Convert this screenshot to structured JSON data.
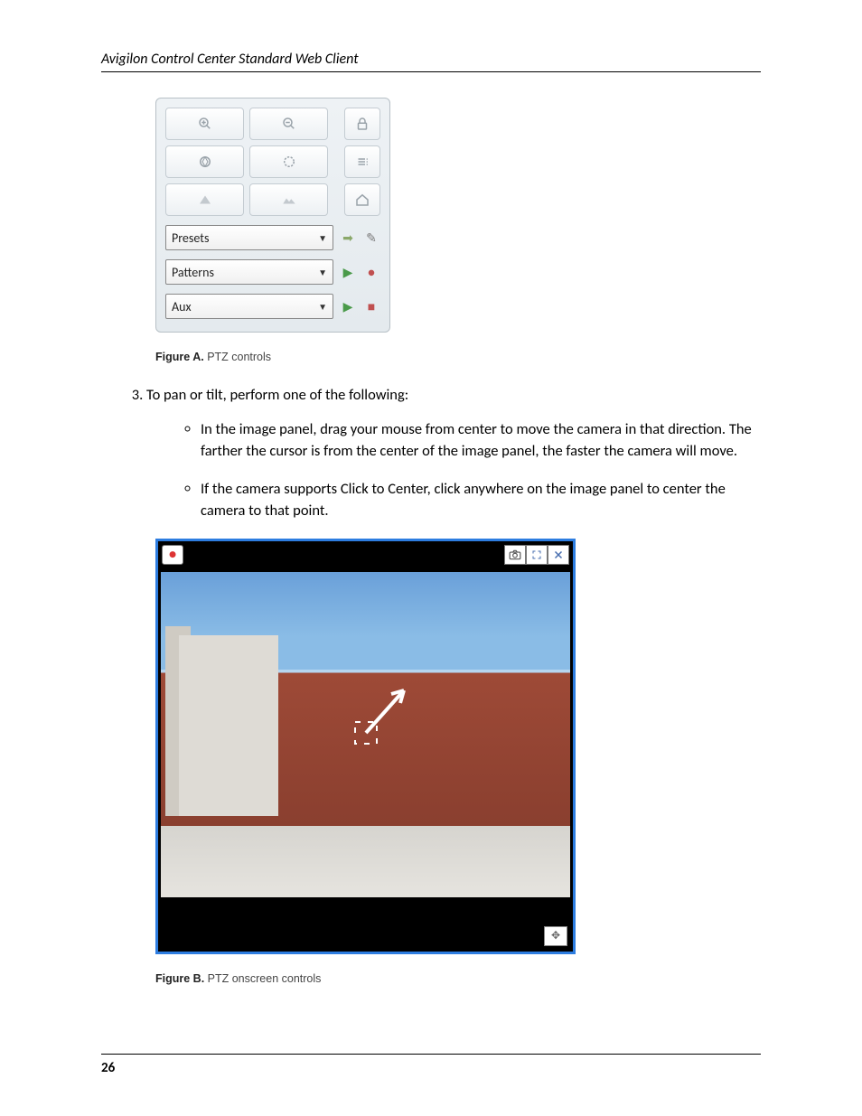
{
  "header": "Avigilon Control Center Standard Web Client",
  "page_number": "26",
  "ptz": {
    "icons": {
      "zoom_in": "zoom-in",
      "zoom_out": "zoom-out",
      "lock": "lock",
      "iris": "iris",
      "focus": "focus",
      "list": "list",
      "near": "near",
      "far": "far",
      "home": "home"
    },
    "presets_label": "Presets",
    "patterns_label": "Patterns",
    "aux_label": "Aux"
  },
  "figA": {
    "prefix": "Figure A.",
    "text": " PTZ controls"
  },
  "step3": {
    "number": "3.",
    "text": "To pan or tilt, perform one of the following:",
    "bullet1": "In the image panel, drag your mouse from center to move the camera in that direction. The farther the cursor is from the center of the image panel, the faster the camera will move.",
    "bullet2": "If the camera supports Click to Center, click anywhere on the image panel to center the camera to that point."
  },
  "figB": {
    "prefix": "Figure B.",
    "text": " PTZ onscreen controls"
  }
}
